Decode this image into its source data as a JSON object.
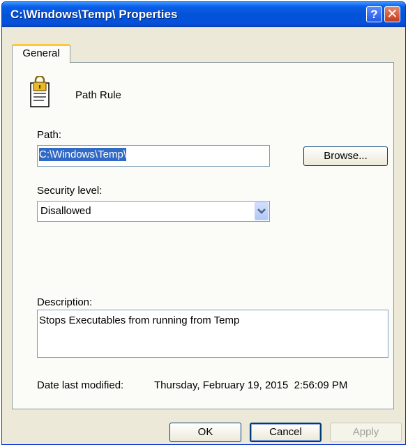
{
  "window": {
    "title": "C:\\Windows\\Temp\\ Properties",
    "help_glyph": "?",
    "close_glyph": "✕"
  },
  "tabs": [
    {
      "label": "General",
      "active": true
    }
  ],
  "rule": {
    "icon": "document-lock-icon",
    "type_label": "Path Rule"
  },
  "path": {
    "label": "Path:",
    "value": "C:\\Windows\\Temp\\",
    "browse_label": "Browse..."
  },
  "security": {
    "label": "Security level:",
    "selected": "Disallowed"
  },
  "description": {
    "label": "Description:",
    "value": "Stops Executables from running from Temp"
  },
  "modified": {
    "label": "Date last modified:",
    "value": "Thursday, February 19, 2015  2:56:09 PM"
  },
  "buttons": {
    "ok": "OK",
    "cancel": "Cancel",
    "apply": "Apply"
  },
  "colors": {
    "titlebar": "#0453d6",
    "dialog_bg": "#ece9d8",
    "selection": "#316ac5",
    "tab_accent": "#ffc83c"
  }
}
